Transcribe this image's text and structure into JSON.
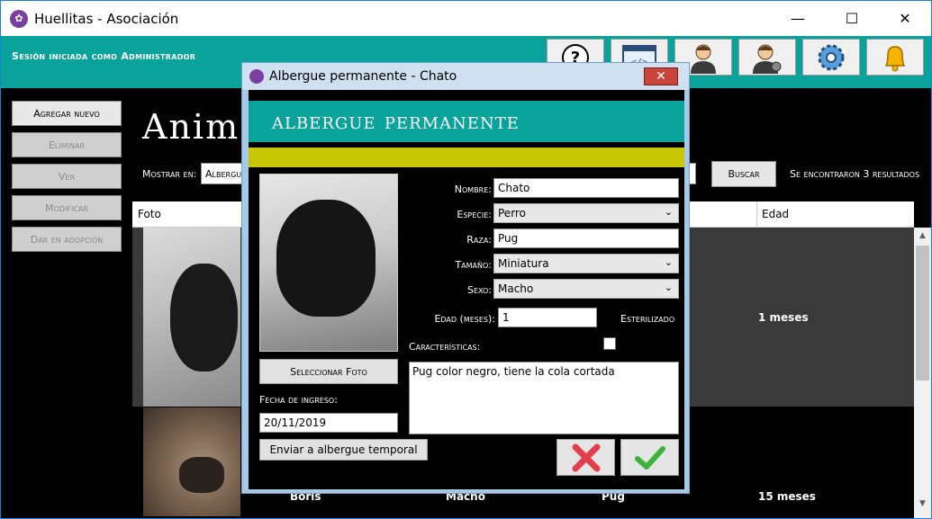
{
  "window": {
    "title": "Huellitas - Asociación",
    "minimize": "—",
    "maximize": "☐",
    "close": "✕"
  },
  "topbar": {
    "session": "Sesión iniciada como Administrador",
    "buttons": [
      {
        "name": "help-icon",
        "glyph": "?"
      },
      {
        "name": "code-icon",
        "glyph": "</>"
      },
      {
        "name": "user-icon",
        "glyph": "👤"
      },
      {
        "name": "user-settings-icon",
        "glyph": "👤"
      },
      {
        "name": "gear-icon",
        "glyph": "⚙"
      },
      {
        "name": "bell-icon",
        "glyph": "🔔"
      }
    ]
  },
  "sidebar": {
    "buttons": [
      {
        "label": "Agregar nuevo",
        "enabled": true
      },
      {
        "label": "Eliminar",
        "enabled": false
      },
      {
        "label": "Ver",
        "enabled": false
      },
      {
        "label": "Modificar",
        "enabled": false
      },
      {
        "label": "Dar en adopción",
        "enabled": false
      }
    ]
  },
  "main": {
    "heading": "Animale",
    "show_in_label": "Mostrar en:",
    "show_in_value": "Albergue",
    "search_button": "Buscar",
    "results": "Se encontraron 3 resultados",
    "columns": [
      "Foto",
      "Edad"
    ],
    "rows": [
      {
        "name": "",
        "sex": "",
        "breed": "",
        "age": "1 meses"
      },
      {
        "name": "Boris",
        "sex": "Macho",
        "breed": "Pug",
        "age": "15 meses"
      }
    ]
  },
  "dialog": {
    "title": "Albergue permanente - Chato",
    "close": "✕",
    "banner": "albergue permanente",
    "fields": {
      "nombre_label": "Nombre:",
      "nombre": "Chato",
      "especie_label": "Especie:",
      "especie": "Perro",
      "raza_label": "Raza:",
      "raza": "Pug",
      "tamano_label": "Tamaño:",
      "tamano": "Miniatura",
      "sexo_label": "Sexo:",
      "sexo": "Macho",
      "edad_label": "Edad (meses):",
      "edad": "1",
      "esterilizado_label": "Esterilizado",
      "caracteristicas_label": "Características:",
      "caracteristicas": "Pug color negro, tiene la cola cortada",
      "fecha_label": "Fecha de ingreso:",
      "fecha": "20/11/2019"
    },
    "select_photo": "Seleccionar Foto",
    "send_temporary": "Enviar a albergue temporal",
    "colors": {
      "accent": "#0aa39b",
      "yellow": "#c7c600",
      "cancel": "#e0404a",
      "ok": "#3cb43c"
    }
  }
}
